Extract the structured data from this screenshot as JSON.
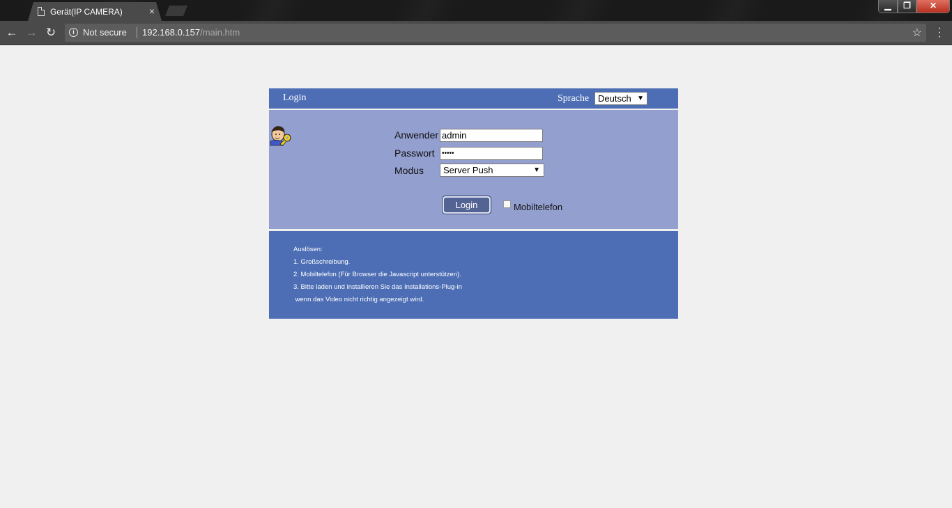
{
  "browser": {
    "tab_title": "Gerät(IP CAMERA)",
    "tab_close": "×",
    "security_label": "Not secure",
    "url_host": "192.168.0.157",
    "url_path": "/main.htm",
    "window_min": "▁",
    "window_max": "❐",
    "window_close": "✕"
  },
  "header": {
    "title": "Login",
    "language_label": "Sprache",
    "language_value": "Deutsch"
  },
  "form": {
    "user_label": "Anwender",
    "user_value": "admin",
    "password_label": "Passwort",
    "password_value": "•••••",
    "mode_label": "Modus",
    "mode_value": "Server Push",
    "login_button": "Login",
    "mobile_label": "Mobiltelefon",
    "mobile_checked": false
  },
  "notes": {
    "heading": "Auslösen:",
    "lines": [
      "1. Großschreibung.",
      "2. Mobiltelefon (Für Browser die Javascript unterstützen).",
      "3. Bitte laden und installieren Sie das Installations-Plug-in",
      " wenn das Video nicht richtig angezeigt wird."
    ]
  },
  "colors": {
    "header_bg": "#4d6eb5",
    "body_bg": "#939fcf",
    "page_bg": "#f0f0f0"
  }
}
